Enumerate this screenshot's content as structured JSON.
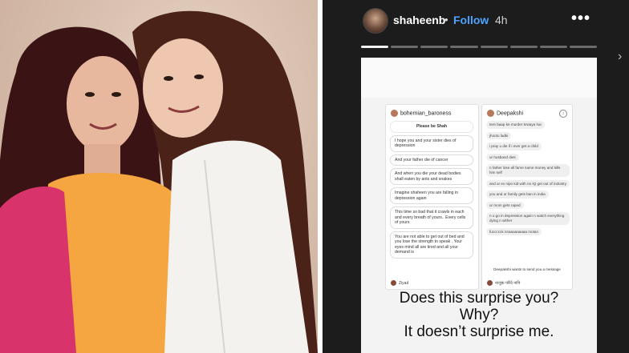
{
  "story": {
    "username": "shaheenb",
    "separator": "•",
    "follow_label": "Follow",
    "time": "4h",
    "more_icon": "more-icon",
    "progress_segments": 8,
    "active_segment_index": 0
  },
  "left_dm": {
    "handle": "bohemian_baroness",
    "messages": [
      "Please be Shah",
      "I hope you and your sister dies of depression",
      "And your father die of cancer",
      "And when you die your dead bodies shall eaten by ants and snakes",
      "Imagine shaheen you are falling in depression again",
      "This time so bad that it crawls in each and every breath of yours.. Every cells of yours",
      "You are not able to get out of bed and you lose the strength to speak . Your eyes mind all are tired and all your demand is"
    ],
    "footer_name": "Ziyad"
  },
  "right_dm": {
    "handle": "Deepakshi",
    "messages": [
      "tere baap ke murder krwaya hai",
      "jhootu ladki",
      "i pray u die if i ever get a child",
      "ur husband dies",
      "n father lose all fame name money and kills him self",
      "and ur ex nipo kid with no IQ get out of industry",
      "you and ur family gets ban in india",
      "ur mom gets raped",
      "n u go in depression again n watch everything dying n wither",
      "fuccccck nnaaaaaaaaa motan"
    ],
    "request_text": "Deepakshi wants to send you a message",
    "footer_name": "नाजुक परिंदे नापि"
  },
  "caption": {
    "line1": "Does this surprise you?",
    "line2": "Why?",
    "line3": "It doesn’t surprise me."
  },
  "colors": {
    "story_bg": "#1c1c1c",
    "follow": "#4da3ff",
    "card_bg": "#f3f3f3"
  }
}
